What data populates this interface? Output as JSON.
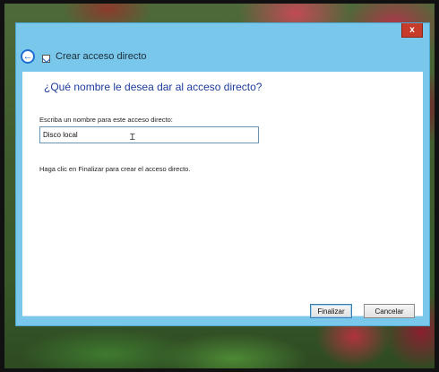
{
  "window": {
    "title": "Crear acceso directo",
    "close_glyph": "x",
    "back_glyph": "←"
  },
  "content": {
    "question": "¿Qué nombre le desea dar al acceso directo?",
    "name_label": "Escriba un nombre para este acceso directo:",
    "name_value": "Disco local",
    "hint": "Haga clic en Finalizar para crear el acceso directo."
  },
  "buttons": {
    "finish": "Finalizar",
    "cancel": "Cancelar"
  },
  "icons": {
    "back": "back-arrow-icon",
    "shortcut": "shortcut-icon",
    "cursor": "text-cursor-icon",
    "close": "close-icon"
  },
  "colors": {
    "titlebar": "#79c7ea",
    "question_text": "#1d3c9b",
    "close_button": "#c73b2a"
  }
}
